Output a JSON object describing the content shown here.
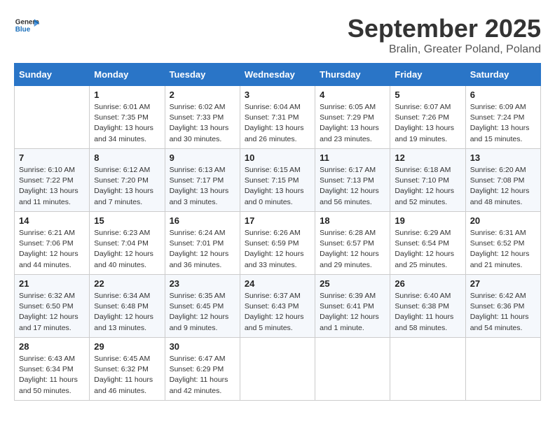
{
  "header": {
    "logo_general": "General",
    "logo_blue": "Blue",
    "month_title": "September 2025",
    "location": "Bralin, Greater Poland, Poland"
  },
  "days_of_week": [
    "Sunday",
    "Monday",
    "Tuesday",
    "Wednesday",
    "Thursday",
    "Friday",
    "Saturday"
  ],
  "weeks": [
    [
      {
        "day": "",
        "info": ""
      },
      {
        "day": "1",
        "info": "Sunrise: 6:01 AM\nSunset: 7:35 PM\nDaylight: 13 hours\nand 34 minutes."
      },
      {
        "day": "2",
        "info": "Sunrise: 6:02 AM\nSunset: 7:33 PM\nDaylight: 13 hours\nand 30 minutes."
      },
      {
        "day": "3",
        "info": "Sunrise: 6:04 AM\nSunset: 7:31 PM\nDaylight: 13 hours\nand 26 minutes."
      },
      {
        "day": "4",
        "info": "Sunrise: 6:05 AM\nSunset: 7:29 PM\nDaylight: 13 hours\nand 23 minutes."
      },
      {
        "day": "5",
        "info": "Sunrise: 6:07 AM\nSunset: 7:26 PM\nDaylight: 13 hours\nand 19 minutes."
      },
      {
        "day": "6",
        "info": "Sunrise: 6:09 AM\nSunset: 7:24 PM\nDaylight: 13 hours\nand 15 minutes."
      }
    ],
    [
      {
        "day": "7",
        "info": "Sunrise: 6:10 AM\nSunset: 7:22 PM\nDaylight: 13 hours\nand 11 minutes."
      },
      {
        "day": "8",
        "info": "Sunrise: 6:12 AM\nSunset: 7:20 PM\nDaylight: 13 hours\nand 7 minutes."
      },
      {
        "day": "9",
        "info": "Sunrise: 6:13 AM\nSunset: 7:17 PM\nDaylight: 13 hours\nand 3 minutes."
      },
      {
        "day": "10",
        "info": "Sunrise: 6:15 AM\nSunset: 7:15 PM\nDaylight: 13 hours\nand 0 minutes."
      },
      {
        "day": "11",
        "info": "Sunrise: 6:17 AM\nSunset: 7:13 PM\nDaylight: 12 hours\nand 56 minutes."
      },
      {
        "day": "12",
        "info": "Sunrise: 6:18 AM\nSunset: 7:10 PM\nDaylight: 12 hours\nand 52 minutes."
      },
      {
        "day": "13",
        "info": "Sunrise: 6:20 AM\nSunset: 7:08 PM\nDaylight: 12 hours\nand 48 minutes."
      }
    ],
    [
      {
        "day": "14",
        "info": "Sunrise: 6:21 AM\nSunset: 7:06 PM\nDaylight: 12 hours\nand 44 minutes."
      },
      {
        "day": "15",
        "info": "Sunrise: 6:23 AM\nSunset: 7:04 PM\nDaylight: 12 hours\nand 40 minutes."
      },
      {
        "day": "16",
        "info": "Sunrise: 6:24 AM\nSunset: 7:01 PM\nDaylight: 12 hours\nand 36 minutes."
      },
      {
        "day": "17",
        "info": "Sunrise: 6:26 AM\nSunset: 6:59 PM\nDaylight: 12 hours\nand 33 minutes."
      },
      {
        "day": "18",
        "info": "Sunrise: 6:28 AM\nSunset: 6:57 PM\nDaylight: 12 hours\nand 29 minutes."
      },
      {
        "day": "19",
        "info": "Sunrise: 6:29 AM\nSunset: 6:54 PM\nDaylight: 12 hours\nand 25 minutes."
      },
      {
        "day": "20",
        "info": "Sunrise: 6:31 AM\nSunset: 6:52 PM\nDaylight: 12 hours\nand 21 minutes."
      }
    ],
    [
      {
        "day": "21",
        "info": "Sunrise: 6:32 AM\nSunset: 6:50 PM\nDaylight: 12 hours\nand 17 minutes."
      },
      {
        "day": "22",
        "info": "Sunrise: 6:34 AM\nSunset: 6:48 PM\nDaylight: 12 hours\nand 13 minutes."
      },
      {
        "day": "23",
        "info": "Sunrise: 6:35 AM\nSunset: 6:45 PM\nDaylight: 12 hours\nand 9 minutes."
      },
      {
        "day": "24",
        "info": "Sunrise: 6:37 AM\nSunset: 6:43 PM\nDaylight: 12 hours\nand 5 minutes."
      },
      {
        "day": "25",
        "info": "Sunrise: 6:39 AM\nSunset: 6:41 PM\nDaylight: 12 hours\nand 1 minute."
      },
      {
        "day": "26",
        "info": "Sunrise: 6:40 AM\nSunset: 6:38 PM\nDaylight: 11 hours\nand 58 minutes."
      },
      {
        "day": "27",
        "info": "Sunrise: 6:42 AM\nSunset: 6:36 PM\nDaylight: 11 hours\nand 54 minutes."
      }
    ],
    [
      {
        "day": "28",
        "info": "Sunrise: 6:43 AM\nSunset: 6:34 PM\nDaylight: 11 hours\nand 50 minutes."
      },
      {
        "day": "29",
        "info": "Sunrise: 6:45 AM\nSunset: 6:32 PM\nDaylight: 11 hours\nand 46 minutes."
      },
      {
        "day": "30",
        "info": "Sunrise: 6:47 AM\nSunset: 6:29 PM\nDaylight: 11 hours\nand 42 minutes."
      },
      {
        "day": "",
        "info": ""
      },
      {
        "day": "",
        "info": ""
      },
      {
        "day": "",
        "info": ""
      },
      {
        "day": "",
        "info": ""
      }
    ]
  ]
}
